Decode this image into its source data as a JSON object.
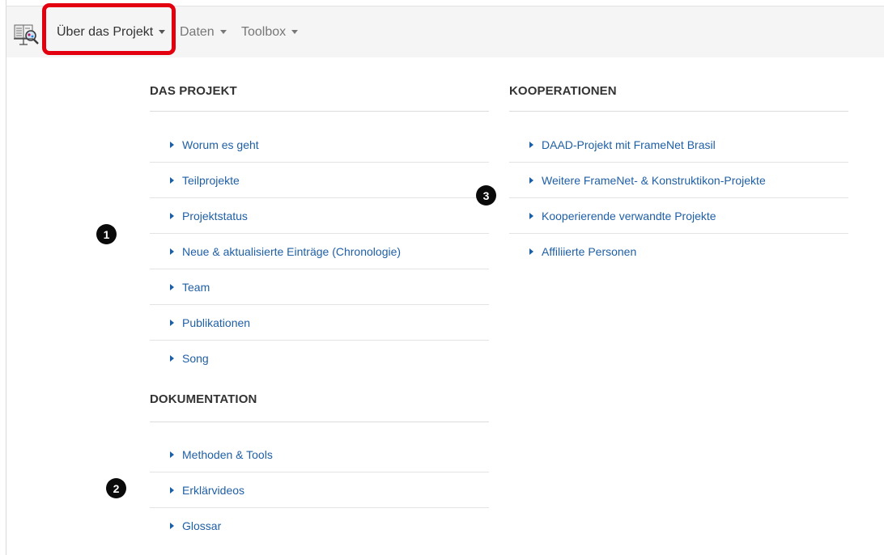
{
  "nav": {
    "logo_icon": "book-magnifier-icon",
    "items": [
      {
        "label": "Über das Projekt",
        "active": true
      },
      {
        "label": "Daten",
        "active": false
      },
      {
        "label": "Toolbox",
        "active": false
      }
    ]
  },
  "sections": {
    "das_projekt": {
      "title": "DAS PROJEKT",
      "items": [
        "Worum es geht",
        "Teilprojekte",
        "Projektstatus",
        "Neue & aktualisierte Einträge (Chronologie)",
        "Team",
        "Publikationen",
        "Song"
      ]
    },
    "dokumentation": {
      "title": "DOKUMENTATION",
      "items": [
        "Methoden & Tools",
        "Erklärvideos",
        "Glossar"
      ]
    },
    "kooperationen": {
      "title": "KOOPERATIONEN",
      "items": [
        "DAAD-Projekt mit FrameNet Brasil",
        "Weitere FrameNet- & Konstruktikon-Projekte",
        "Kooperierende verwandte Projekte",
        "Affiliierte Personen"
      ]
    }
  },
  "badges": [
    "1",
    "2",
    "3"
  ],
  "colors": {
    "link": "#1f5fa6",
    "highlight": "#e3000f",
    "navbar_bg": "#f5f5f5",
    "badge": "#0a0a0a"
  }
}
